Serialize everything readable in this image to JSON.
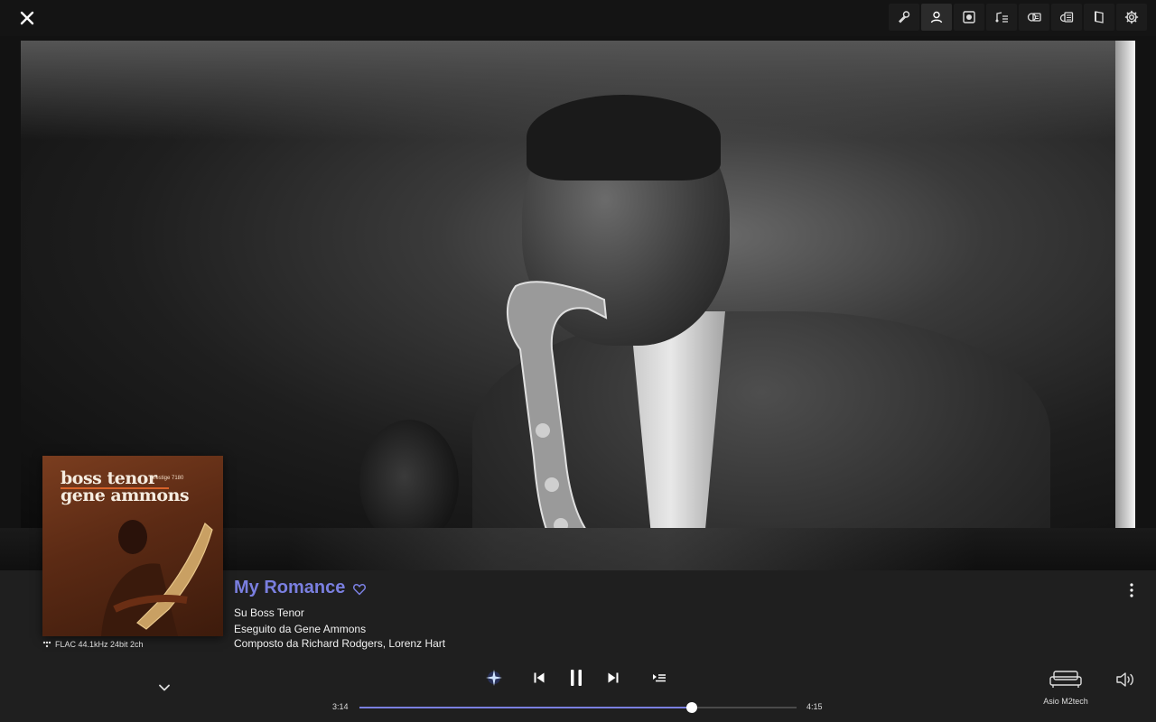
{
  "track": {
    "title": "My Romance",
    "album_line": "Su Boss Tenor",
    "artist_line": "Eseguito da Gene Ammons",
    "composer_line": "Composto da Richard Rodgers, Lorenz Hart"
  },
  "cover": {
    "title_line1": "boss tenor",
    "title_line2": "gene ammons",
    "label_text": "prestige 7180"
  },
  "audio_quality": "FLAC 44.1kHz 24bit 2ch",
  "playback": {
    "current_time": "3:14",
    "total_time": "4:15",
    "progress_fraction": 0.76,
    "state": "playing"
  },
  "device": {
    "name": "Asio M2tech"
  },
  "toolbar": {
    "icons": [
      "microphone-icon",
      "artist-icon",
      "album-icon",
      "lyrics-icon",
      "review-icon",
      "credits-icon",
      "booklet-icon",
      "settings-icon"
    ],
    "active_index": 1
  },
  "colors": {
    "accent": "#7a7fe0",
    "panel": "#1f1f1f",
    "background": "#121212"
  }
}
